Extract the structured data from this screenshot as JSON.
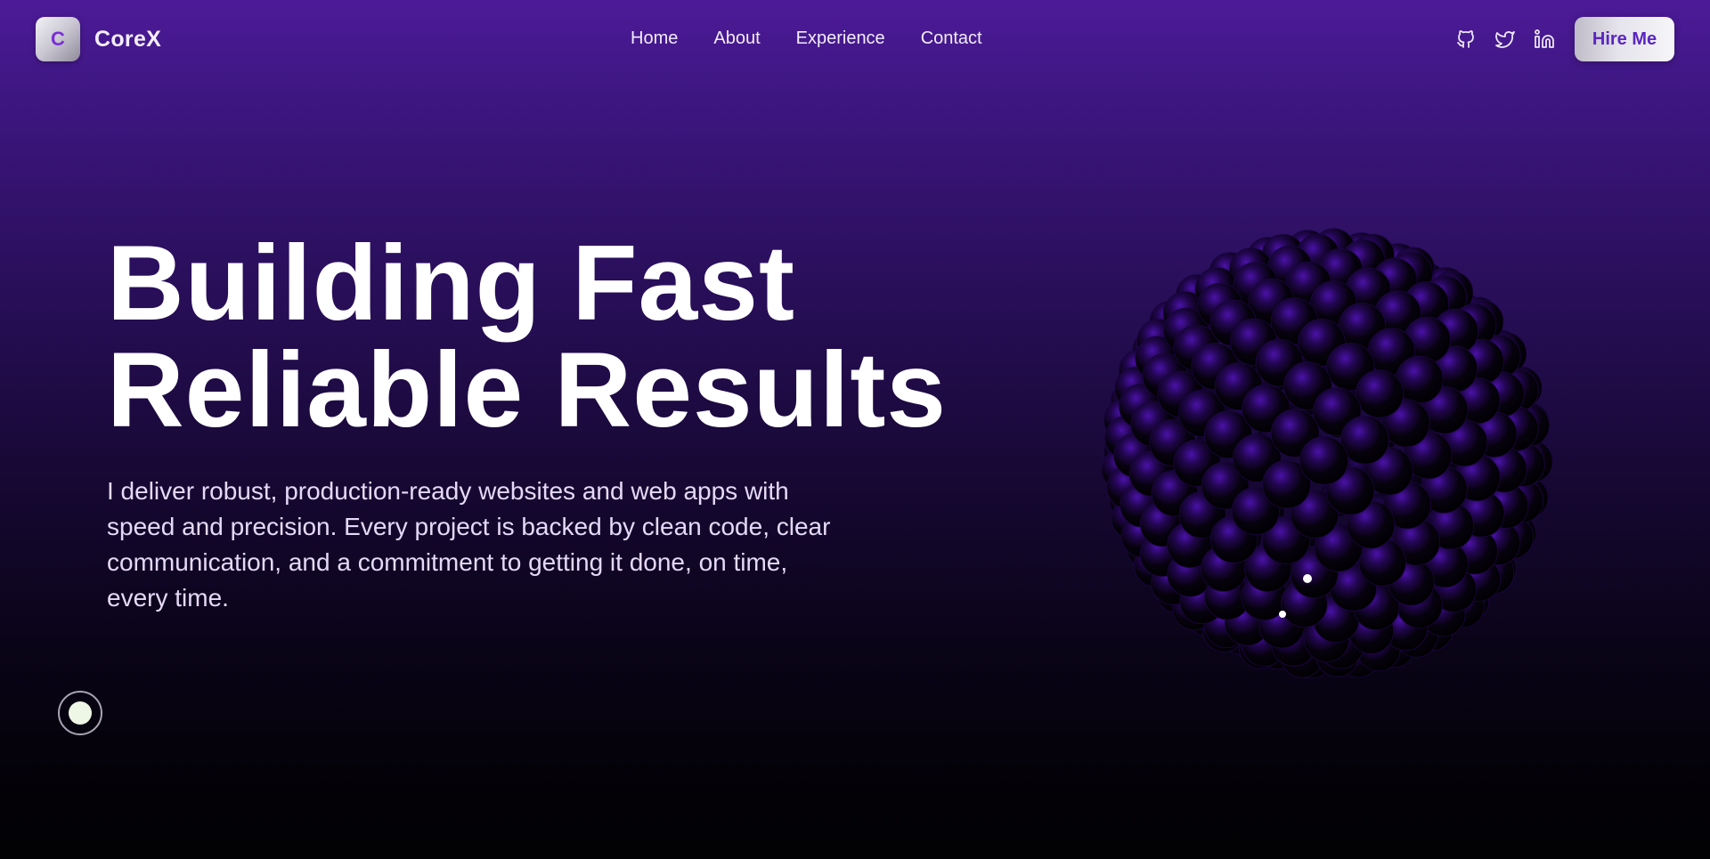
{
  "brand": {
    "initial": "C",
    "name": "CoreX"
  },
  "nav": {
    "links": [
      {
        "label": "Home"
      },
      {
        "label": "About"
      },
      {
        "label": "Experience"
      },
      {
        "label": "Contact"
      }
    ]
  },
  "social": {
    "icons": [
      {
        "icon": "github-icon"
      },
      {
        "icon": "twitter-icon"
      },
      {
        "icon": "linkedin-icon"
      }
    ]
  },
  "cta": {
    "label": "Hire Me"
  },
  "hero": {
    "title_line1": "Building Fast",
    "title_line2": "Reliable Results",
    "description": "I deliver robust, production-ready websites and web apps with speed and precision. Every project is backed by clean code, clear communication, and a commitment to getting it done, on time, every time."
  },
  "colors": {
    "accent": "#7a2ed8",
    "cta_text": "#5a26c0",
    "bg_top": "#4c1a97",
    "bg_bottom": "#020104",
    "sphere_ball": "#0a0414",
    "sphere_glow": "#4a12a8"
  },
  "decor": {
    "sphere": "ball-sphere-3d",
    "toggle": "theme-toggle-icon"
  }
}
